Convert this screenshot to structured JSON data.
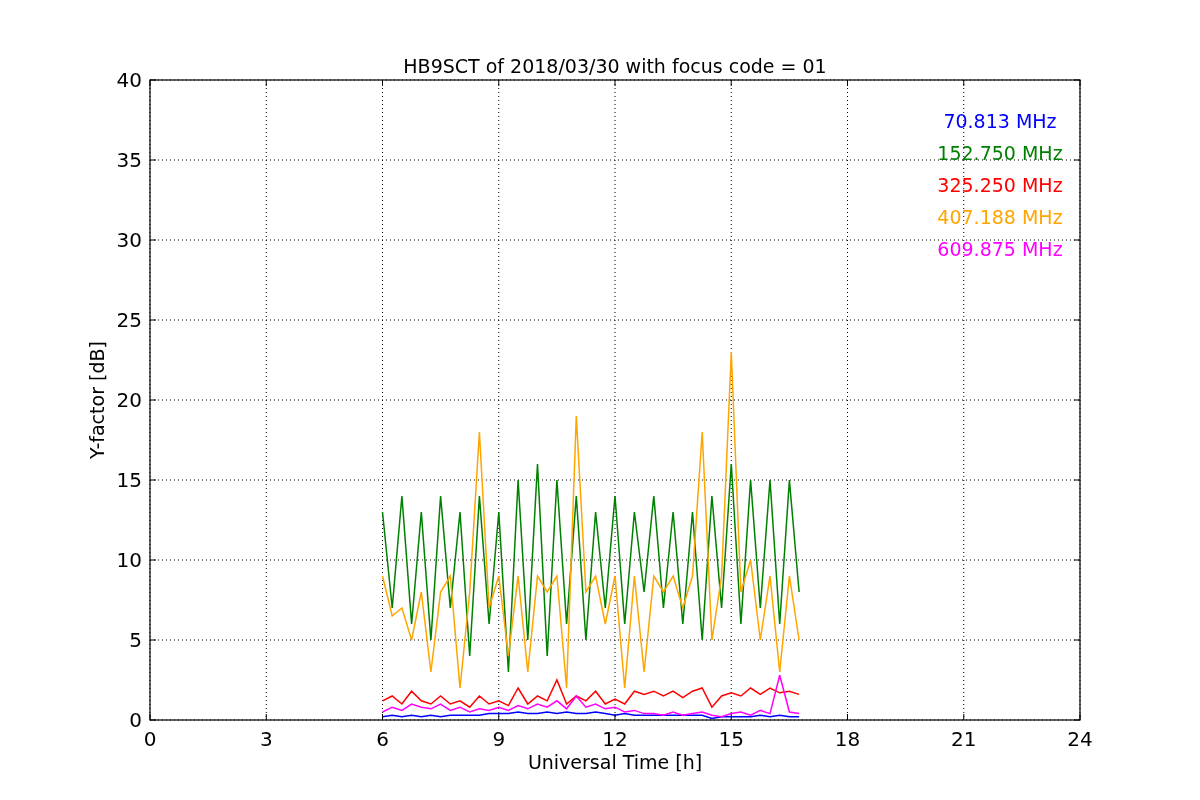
{
  "chart": {
    "chart_data": {
      "type": "line",
      "title": "HB9SCT of 2018/03/30 with focus code = 01",
      "xlabel": "Universal Time [h]",
      "ylabel": "Y-factor [dB]",
      "x": [
        6,
        6.25,
        6.5,
        6.75,
        7,
        7.25,
        7.5,
        7.75,
        8,
        8.25,
        8.5,
        8.75,
        9,
        9.25,
        9.5,
        9.75,
        10,
        10.25,
        10.5,
        10.75,
        11,
        11.25,
        11.5,
        11.75,
        12,
        12.25,
        12.5,
        12.75,
        13,
        13.25,
        13.5,
        13.75,
        14,
        14.25,
        14.5,
        14.75,
        15,
        15.25,
        15.5,
        15.75,
        16,
        16.25,
        16.5,
        16.75
      ],
      "series": [
        {
          "name": "70.813 MHz",
          "color": "#0000ff",
          "values": [
            0.2,
            0.3,
            0.2,
            0.3,
            0.2,
            0.3,
            0.2,
            0.3,
            0.3,
            0.3,
            0.3,
            0.4,
            0.4,
            0.4,
            0.5,
            0.4,
            0.4,
            0.5,
            0.4,
            0.5,
            0.4,
            0.4,
            0.5,
            0.4,
            0.3,
            0.4,
            0.3,
            0.3,
            0.3,
            0.3,
            0.3,
            0.3,
            0.3,
            0.3,
            0.1,
            0.2,
            0.2,
            0.2,
            0.2,
            0.3,
            0.2,
            0.3,
            0.2,
            0.2
          ]
        },
        {
          "name": "152.750 MHz",
          "color": "#008000",
          "values": [
            13,
            7,
            14,
            6,
            13,
            5,
            14,
            7,
            13,
            4,
            14,
            6,
            13,
            3,
            15,
            5,
            16,
            4,
            15,
            6,
            14,
            5,
            13,
            7,
            14,
            6,
            13,
            8,
            14,
            7,
            13,
            6,
            13,
            5,
            14,
            7,
            16,
            6,
            15,
            7,
            15,
            6,
            15,
            8
          ]
        },
        {
          "name": "325.250 MHz",
          "color": "#ff0000",
          "values": [
            1.2,
            1.5,
            1,
            1.8,
            1.2,
            1,
            1.5,
            1,
            1.2,
            0.8,
            1.5,
            1,
            1.2,
            0.9,
            2,
            1,
            1.5,
            1.2,
            2.5,
            1,
            1.5,
            1.2,
            1.8,
            1,
            1.3,
            1,
            1.8,
            1.6,
            1.8,
            1.5,
            1.8,
            1.4,
            1.8,
            2,
            0.8,
            1.5,
            1.7,
            1.5,
            2,
            1.6,
            2,
            1.7,
            1.8,
            1.6
          ]
        },
        {
          "name": "407.188 MHz",
          "color": "#ffa500",
          "values": [
            9,
            6.5,
            7,
            5,
            8,
            3,
            8,
            9,
            2,
            8,
            18,
            7,
            9,
            4,
            9,
            3,
            9,
            8,
            9,
            2,
            19,
            8,
            9,
            6,
            9,
            2,
            9,
            3,
            9,
            8,
            9,
            7,
            9,
            18,
            5,
            9,
            23,
            8,
            10,
            5,
            9,
            3,
            9,
            5
          ]
        },
        {
          "name": "609.875 MHz",
          "color": "#ff00ff",
          "values": [
            0.5,
            0.8,
            0.6,
            1,
            0.8,
            0.7,
            1,
            0.6,
            0.8,
            0.5,
            0.7,
            0.6,
            0.8,
            0.6,
            0.9,
            0.7,
            1,
            0.8,
            1.2,
            0.7,
            1.5,
            0.8,
            1,
            0.7,
            0.8,
            0.5,
            0.6,
            0.4,
            0.4,
            0.3,
            0.5,
            0.3,
            0.4,
            0.5,
            0.3,
            0.2,
            0.4,
            0.5,
            0.3,
            0.6,
            0.4,
            2.8,
            0.5,
            0.4
          ]
        }
      ],
      "grid": true,
      "xlim": [
        0,
        24
      ],
      "ylim": [
        0,
        40
      ],
      "xticks": [
        0,
        3,
        6,
        9,
        12,
        15,
        18,
        21,
        24
      ],
      "yticks": [
        0,
        5,
        10,
        15,
        20,
        25,
        30,
        35,
        40
      ]
    }
  }
}
